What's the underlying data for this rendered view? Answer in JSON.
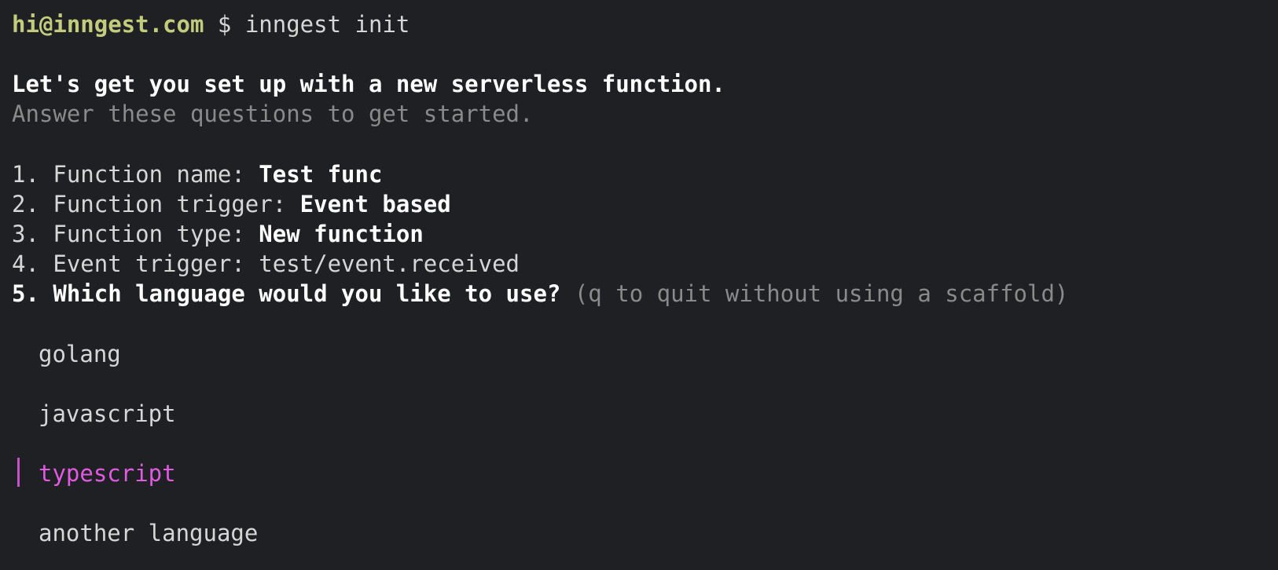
{
  "prompt": {
    "user": "hi@inngest.com",
    "symbol": "$",
    "command": "inngest init"
  },
  "intro": {
    "heading": "Let's get you set up with a new serverless function.",
    "subheading": "Answer these questions to get started."
  },
  "questions": [
    {
      "label": "1. Function name: ",
      "answer": "Test func",
      "answer_style": "bold"
    },
    {
      "label": "2. Function trigger: ",
      "answer": "Event based",
      "answer_style": "bold"
    },
    {
      "label": "3. Function type: ",
      "answer": "New function",
      "answer_style": "bold"
    },
    {
      "label": "4. Event trigger: ",
      "answer": "test/event.received",
      "answer_style": "normal"
    }
  ],
  "current_question": {
    "label": "5. Which language would you like to use?",
    "hint": " (q to quit without using a scaffold)"
  },
  "language_options": [
    {
      "label": "golang",
      "selected": false
    },
    {
      "label": "javascript",
      "selected": false
    },
    {
      "label": "typescript",
      "selected": true
    },
    {
      "label": "another language",
      "selected": false
    }
  ],
  "colors": {
    "background": "#1f2023",
    "prompt_user": "#c3cc7c",
    "text": "#d6d6d6",
    "dim": "#8a8a8a",
    "selected": "#e25ae2"
  }
}
